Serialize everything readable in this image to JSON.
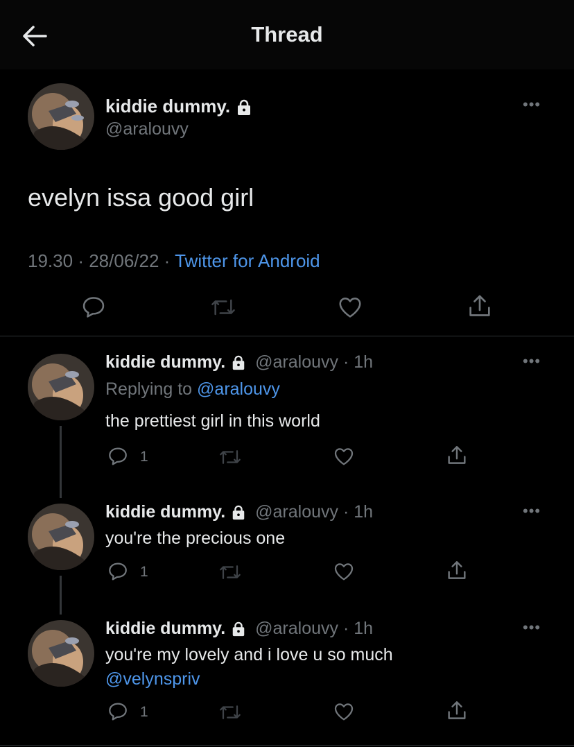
{
  "header": {
    "title": "Thread"
  },
  "main_tweet": {
    "display_name": "kiddie dummy.",
    "handle": "@aralouvy",
    "text": "evelyn issa good girl",
    "time": "19.30",
    "sep1": "·",
    "date": "28/06/22",
    "sep2": "·",
    "source": "Twitter for Android"
  },
  "replies": [
    {
      "display_name": "kiddie dummy.",
      "handle": "@aralouvy",
      "sep": "·",
      "time": "1h",
      "replying_label": "Replying to",
      "replying_to": "@aralouvy",
      "text": "the prettiest girl in this world",
      "reply_count": "1"
    },
    {
      "display_name": "kiddie dummy.",
      "handle": "@aralouvy",
      "sep": "·",
      "time": "1h",
      "text": "you're the precious one",
      "reply_count": "1"
    },
    {
      "display_name": "kiddie dummy.",
      "handle": "@aralouvy",
      "sep": "·",
      "time": "1h",
      "text": "you're my lovely and i love u so much",
      "mention": "@velynspriv",
      "reply_count": "1"
    }
  ],
  "colors": {
    "background": "#000000",
    "text": "#e7e9ea",
    "muted": "#71767b",
    "link": "#4e96ea"
  },
  "icons": [
    "back-arrow-icon",
    "lock-icon",
    "more-icon",
    "reply-icon",
    "retweet-icon",
    "like-icon",
    "share-icon"
  ]
}
